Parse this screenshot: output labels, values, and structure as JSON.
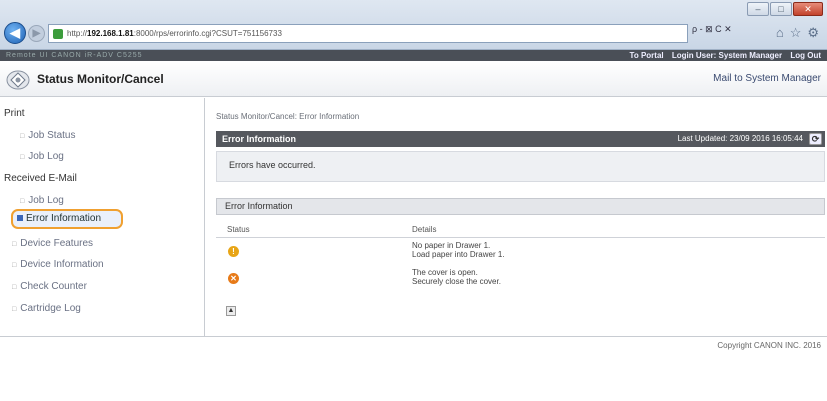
{
  "browser": {
    "address_prefix": "http://",
    "address_host": "192.168.1.81",
    "address_rest": ":8000/rps/errorinfo.cgi?CSUT=751156733",
    "search_tools": "ρ - ⊠ C ✕",
    "icons": [
      "home-icon",
      "favorites-icon",
      "settings-icon"
    ]
  },
  "topbar": {
    "left_text": "Remote UI    CANON iR-ADV C5255",
    "portal_link": "To Portal",
    "login_user": "Login User: System Manager",
    "logout_link": "Log Out"
  },
  "header": {
    "title": "Status Monitor/Cancel",
    "mail_link": "Mail to System Manager"
  },
  "sidebar": {
    "print_heading": "Print",
    "print_job_status": "Job Status",
    "print_job_log": "Job Log",
    "email_heading": "Received E-Mail",
    "email_job_log": "Job Log",
    "error_information": "Error Information",
    "device_features": "Device Features",
    "device_information": "Device Information",
    "check_counter": "Check Counter",
    "cartridge_log": "Cartridge Log"
  },
  "main": {
    "breadcrumb": "Status Monitor/Cancel: Error Information",
    "panel_title": "Error Information",
    "last_updated": "Last Updated: 23/09 2016 16:05:44",
    "message": "Errors have occurred.",
    "section_title": "Error Information",
    "col_status": "Status",
    "col_details": "Details",
    "rows": [
      {
        "status_icon": "warning-icon",
        "line1": "No paper in Drawer 1.",
        "line2": "Load paper into Drawer 1."
      },
      {
        "status_icon": "error-icon",
        "line1": "The cover is open.",
        "line2": "Securely close the cover."
      }
    ]
  },
  "footer": {
    "copyright": "Copyright CANON INC. 2016"
  },
  "colors": {
    "header_bar": "#55585e",
    "highlight_ring": "#f0a030",
    "warning": "#e8a516",
    "error": "#e77a18"
  }
}
